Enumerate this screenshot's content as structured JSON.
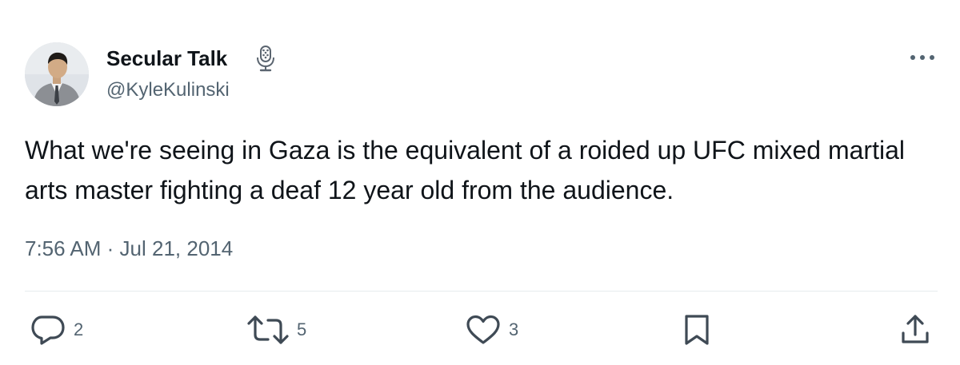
{
  "author": {
    "display_name": "Secular Talk",
    "badge_icon": "microphone-icon",
    "handle": "@KyleKulinski"
  },
  "tweet": {
    "text": "What we're seeing in Gaza is the equivalent of a roided up UFC mixed martial arts master fighting a deaf 12 year old from the audience.",
    "time": "7:56 AM",
    "separator": "·",
    "date": "Jul 21, 2014"
  },
  "actions": {
    "replies": {
      "icon": "reply-icon",
      "count": "2"
    },
    "retweets": {
      "icon": "retweet-icon",
      "count": "5"
    },
    "likes": {
      "icon": "heart-icon",
      "count": "3"
    },
    "bookmark": {
      "icon": "bookmark-icon"
    },
    "share": {
      "icon": "share-icon"
    }
  },
  "colors": {
    "text_primary": "#0f1419",
    "text_secondary": "#536471",
    "divider": "#e7ebee"
  }
}
